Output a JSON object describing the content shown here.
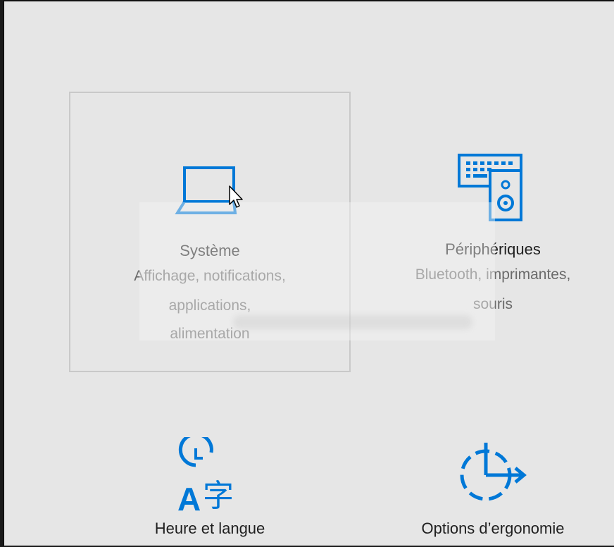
{
  "tiles": [
    {
      "title": "Système",
      "desc": [
        "Affichage, notifications,",
        "applications,",
        "alimentation"
      ],
      "icon": "laptop-icon"
    },
    {
      "title": "Périphériques",
      "desc": [
        "Bluetooth, imprimantes,",
        "souris"
      ],
      "icon": "devices-icon"
    },
    {
      "title": "Heure et langue",
      "desc": [],
      "icon": "time-language-icon"
    },
    {
      "title": "Options d’ergonomie",
      "desc": [],
      "icon": "ease-of-access-icon"
    }
  ],
  "watermark": {
    "text": "PC ASTUCES"
  },
  "colors": {
    "accent": "#0078d7",
    "background": "#e6e6e6",
    "title": "#1f1f1f",
    "description": "#6a6a6a",
    "selection_border": "#c9c9c9"
  }
}
